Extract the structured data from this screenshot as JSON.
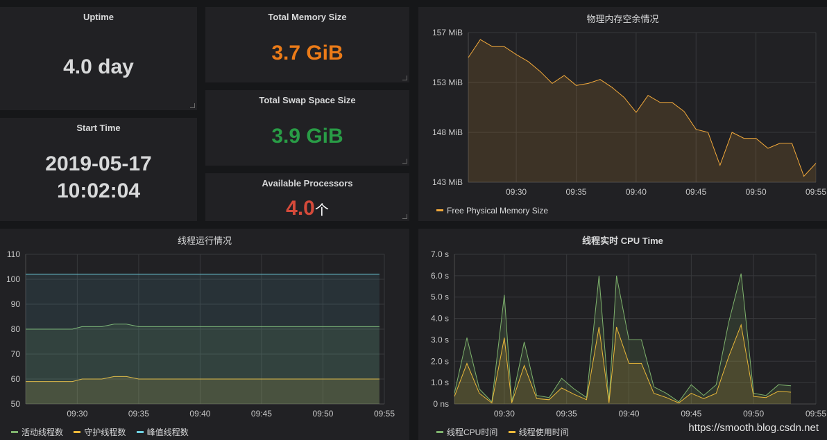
{
  "stats": {
    "uptime": {
      "title": "Uptime",
      "value": "4.0 day",
      "color": "#d8d9da"
    },
    "start_time": {
      "title": "Start Time",
      "date": "2019-05-17",
      "time": "10:02:04",
      "color": "#d8d9da"
    },
    "total_memory": {
      "title": "Total Memory Size",
      "value": "3.7 GiB",
      "color": "#eb7b18"
    },
    "total_swap": {
      "title": "Total Swap Space Size",
      "value": "3.9 GiB",
      "color": "#299c46"
    },
    "processors": {
      "title": "Available Processors",
      "value": "4.0",
      "unit": "个",
      "color": "#d44a3a"
    }
  },
  "chart_data": [
    {
      "type": "area",
      "title": "物理内存空余情况",
      "y_ticks": [
        "157 MiB",
        "153 MiB",
        "148 MiB",
        "143 MiB"
      ],
      "x_ticks": [
        "09:30",
        "09:35",
        "09:40",
        "09:45",
        "09:50",
        "09:55"
      ],
      "ylim": [
        143,
        158
      ],
      "xlim_minutes": [
        26,
        55
      ],
      "series": [
        {
          "name": "Free Physical Memory Size",
          "color": "#f2a93b",
          "fill": "rgba(234,160,60,0.14)",
          "points": [
            [
              26,
              155.5
            ],
            [
              27,
              157.3
            ],
            [
              28,
              156.6
            ],
            [
              29,
              156.6
            ],
            [
              30,
              155.8
            ],
            [
              31,
              155.1
            ],
            [
              32,
              154.1
            ],
            [
              33,
              152.9
            ],
            [
              34,
              153.7
            ],
            [
              35,
              152.7
            ],
            [
              36,
              152.9
            ],
            [
              37,
              153.3
            ],
            [
              38,
              152.5
            ],
            [
              39,
              151.5
            ],
            [
              40,
              150.0
            ],
            [
              41,
              151.7
            ],
            [
              42,
              151.0
            ],
            [
              43,
              151.0
            ],
            [
              44,
              150.1
            ],
            [
              45,
              148.3
            ],
            [
              46,
              148.0
            ],
            [
              47,
              144.7
            ],
            [
              48,
              148.0
            ],
            [
              49,
              147.4
            ],
            [
              50,
              147.4
            ],
            [
              51,
              146.4
            ],
            [
              52,
              146.9
            ],
            [
              53,
              146.9
            ],
            [
              54,
              143.6
            ],
            [
              55,
              144.9
            ]
          ]
        }
      ]
    },
    {
      "type": "area",
      "title": "线程运行情况",
      "y_ticks": [
        "110",
        "100",
        "90",
        "80",
        "70",
        "60",
        "50"
      ],
      "x_ticks": [
        "09:30",
        "09:35",
        "09:40",
        "09:45",
        "09:50",
        "09:55"
      ],
      "ylim": [
        50,
        110
      ],
      "xlim_minutes": [
        25.8,
        55
      ],
      "series": [
        {
          "name": "活动线程数",
          "color": "#7eb26d",
          "fill": "rgba(126,178,109,0.12)",
          "points": [
            [
              25.8,
              80
            ],
            [
              29.6,
              80
            ],
            [
              30.4,
              81
            ],
            [
              32,
              81
            ],
            [
              33,
              82
            ],
            [
              34,
              82
            ],
            [
              35,
              81
            ],
            [
              54.6,
              81
            ]
          ]
        },
        {
          "name": "守护线程数",
          "color": "#eab839",
          "fill": "rgba(234,184,57,0.14)",
          "points": [
            [
              25.8,
              59
            ],
            [
              29.6,
              59
            ],
            [
              30.4,
              60
            ],
            [
              32,
              60
            ],
            [
              33,
              61
            ],
            [
              34,
              61
            ],
            [
              35,
              60
            ],
            [
              54.6,
              60
            ]
          ]
        },
        {
          "name": "峰值线程数",
          "color": "#6ed0e0",
          "fill": "rgba(110,208,224,0.10)",
          "points": [
            [
              25.8,
              102
            ],
            [
              54.6,
              102
            ]
          ]
        }
      ]
    },
    {
      "type": "area",
      "title": "线程实时 CPU Time",
      "y_ticks": [
        "7.0 s",
        "6.0 s",
        "5.0 s",
        "4.0 s",
        "3.0 s",
        "2.0 s",
        "1.0 s",
        "0 ns"
      ],
      "x_ticks": [
        "09:30",
        "09:35",
        "09:40",
        "09:45",
        "09:50",
        "09:55"
      ],
      "ylim": [
        0,
        7
      ],
      "xlim_minutes": [
        26,
        55
      ],
      "series": [
        {
          "name": "线程CPU时间",
          "color": "#7eb26d",
          "fill": "rgba(126,178,109,0.15)",
          "points": [
            [
              26,
              0.5
            ],
            [
              27,
              3.1
            ],
            [
              28,
              0.7
            ],
            [
              29,
              0.1
            ],
            [
              30,
              5.1
            ],
            [
              30.6,
              0.1
            ],
            [
              31.6,
              2.9
            ],
            [
              32.6,
              0.4
            ],
            [
              33.6,
              0.3
            ],
            [
              34.6,
              1.2
            ],
            [
              35.6,
              0.7
            ],
            [
              36.6,
              0.3
            ],
            [
              37.6,
              6.0
            ],
            [
              38.4,
              0.1
            ],
            [
              39,
              6.0
            ],
            [
              40,
              3.0
            ],
            [
              41,
              3.0
            ],
            [
              42,
              0.8
            ],
            [
              43,
              0.5
            ],
            [
              44,
              0.1
            ],
            [
              45,
              0.9
            ],
            [
              46,
              0.4
            ],
            [
              47,
              0.9
            ],
            [
              48,
              3.8
            ],
            [
              49,
              6.1
            ],
            [
              50,
              0.5
            ],
            [
              51,
              0.4
            ],
            [
              52,
              0.9
            ],
            [
              53,
              0.85
            ]
          ]
        },
        {
          "name": "线程使用时间",
          "color": "#eab839",
          "fill": "rgba(234,184,57,0.15)",
          "points": [
            [
              26,
              0.35
            ],
            [
              27,
              1.9
            ],
            [
              28,
              0.5
            ],
            [
              29,
              0.05
            ],
            [
              30,
              3.1
            ],
            [
              30.6,
              0.05
            ],
            [
              31.6,
              1.8
            ],
            [
              32.6,
              0.25
            ],
            [
              33.6,
              0.2
            ],
            [
              34.6,
              0.75
            ],
            [
              35.6,
              0.45
            ],
            [
              36.6,
              0.2
            ],
            [
              37.6,
              3.6
            ],
            [
              38.4,
              0.05
            ],
            [
              39,
              3.6
            ],
            [
              40,
              1.9
            ],
            [
              41,
              1.9
            ],
            [
              42,
              0.5
            ],
            [
              43,
              0.3
            ],
            [
              44,
              0.05
            ],
            [
              45,
              0.5
            ],
            [
              46,
              0.25
            ],
            [
              47,
              0.5
            ],
            [
              48,
              2.2
            ],
            [
              49,
              3.7
            ],
            [
              50,
              0.35
            ],
            [
              51,
              0.3
            ],
            [
              52,
              0.6
            ],
            [
              53,
              0.55
            ]
          ]
        }
      ]
    }
  ],
  "watermark": "https://smooth.blog.csdn.net"
}
